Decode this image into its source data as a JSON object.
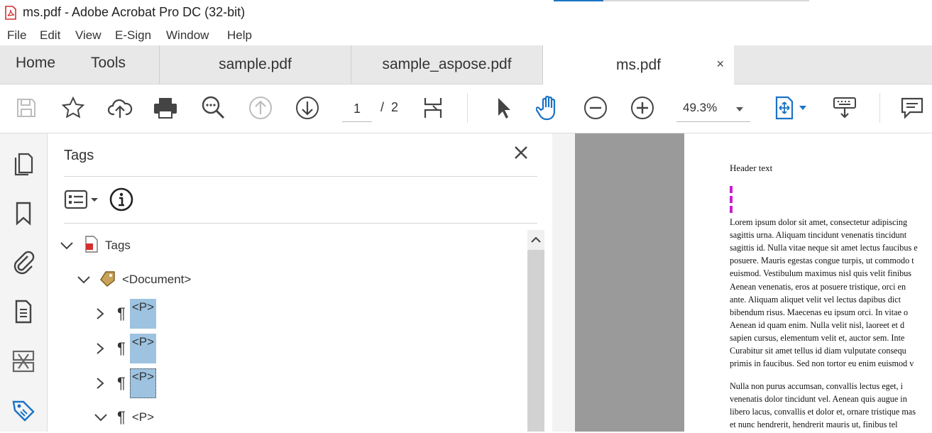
{
  "window": {
    "title": "ms.pdf - Adobe Acrobat Pro DC (32-bit)"
  },
  "menu": [
    "File",
    "Edit",
    "View",
    "E-Sign",
    "Window",
    "Help"
  ],
  "tabs": {
    "home": "Home",
    "tools": "Tools",
    "docs": [
      "sample.pdf",
      "sample_aspose.pdf",
      "ms.pdf"
    ],
    "close": "×"
  },
  "toolbar": {
    "page_current": "1",
    "page_sep": "/",
    "page_total": "2",
    "zoom": "49.3%"
  },
  "panel": {
    "title": "Tags",
    "tree": [
      {
        "label": "Tags",
        "icon": "pdf-file-icon",
        "expanded": true
      },
      {
        "label": "<Document>",
        "icon": "tag-icon",
        "expanded": true
      },
      {
        "label": "<P>",
        "icon": "pilcrow-icon",
        "expanded": false,
        "selected": true
      },
      {
        "label": "<P>",
        "icon": "pilcrow-icon",
        "expanded": false,
        "selected": true
      },
      {
        "label": "<P>",
        "icon": "pilcrow-icon",
        "expanded": false,
        "selected": true,
        "focused": true
      },
      {
        "label": "<P>",
        "icon": "pilcrow-icon",
        "expanded": true,
        "selected": false
      }
    ]
  },
  "document": {
    "header_text": "Header text",
    "paragraphs": [
      [
        "Lorem ipsum dolor sit amet, consectetur adipiscing",
        "sagittis urna. Aliquam tincidunt venenatis tincidunt",
        "sagittis id. Nulla vitae neque sit amet lectus faucibus e",
        "posuere. Mauris egestas congue turpis, ut commodo t",
        "euismod. Vestibulum maximus nisl quis velit finibus"
      ],
      [
        "Aenean venenatis, eros at posuere tristique, orci en",
        "ante. Aliquam aliquet velit vel lectus dapibus dict",
        "bibendum risus. Maecenas eu ipsum orci. In vitae o",
        "Aenean id quam enim. Nulla velit nisl, laoreet et d",
        "sapien cursus, elementum velit et, auctor sem. Inte",
        "Curabitur sit amet tellus id diam vulputate consequ",
        "primis in faucibus. Sed non tortor eu enim euismod v"
      ],
      [
        "Nulla non purus accumsan, convallis lectus eget, i",
        "venenatis dolor tincidunt vel. Aenean quis augue in",
        "libero lacus, convallis et dolor et, ornare tristique mas",
        "et nunc hendrerit, hendrerit mauris ut, finibus tel"
      ]
    ]
  },
  "colors": {
    "accent": "#1a73c4",
    "selection": "#9dc3e0",
    "marker": "#c81fd0"
  }
}
